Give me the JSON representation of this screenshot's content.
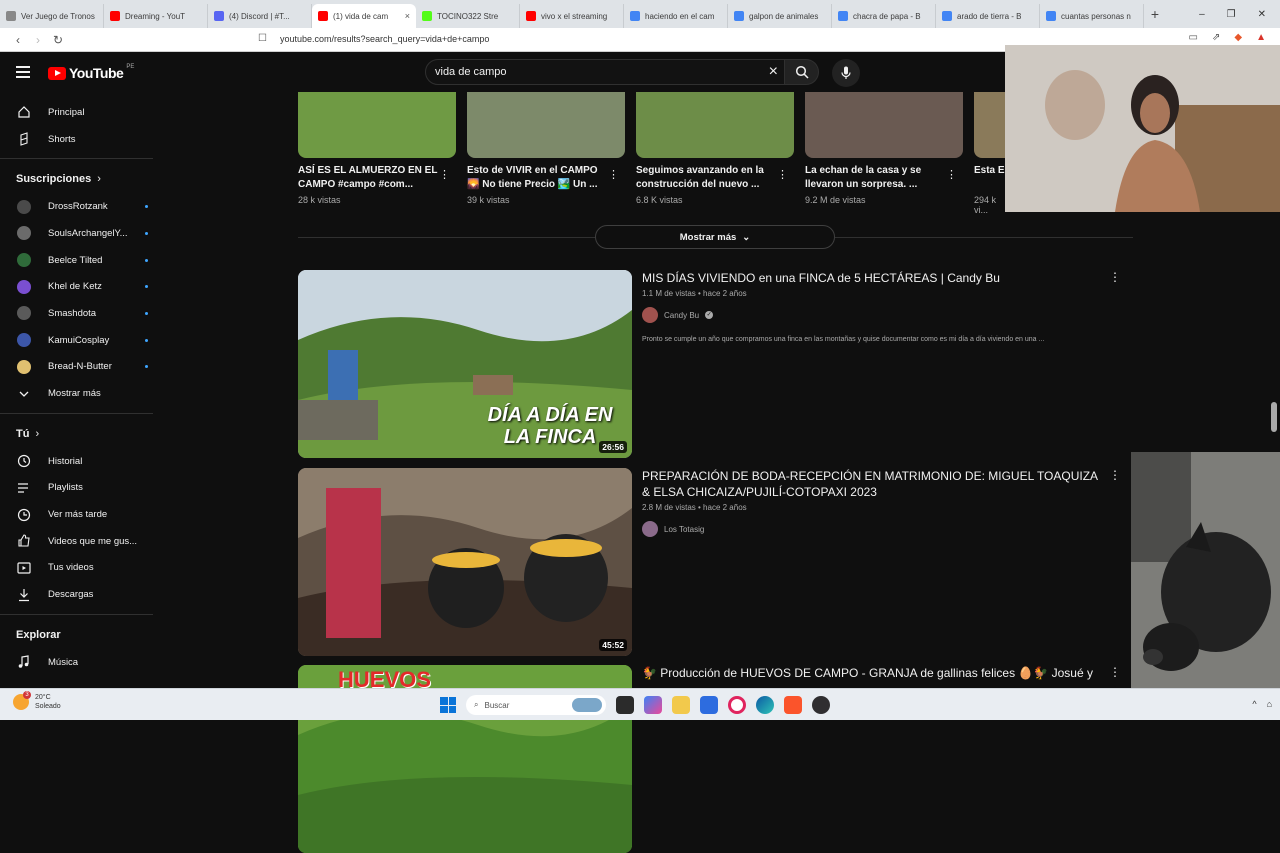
{
  "browser": {
    "tabs": [
      {
        "label": "Ver Juego de Tronos",
        "color": "#888888"
      },
      {
        "label": "Dreaming - YouT",
        "color": "#ff0000"
      },
      {
        "label": "(4) Discord | #T...",
        "color": "#5865f2"
      },
      {
        "label": "(1) vida de cam",
        "color": "#ff0000",
        "active": true
      },
      {
        "label": "TOCINO322 Stre",
        "color": "#53fc18"
      },
      {
        "label": "vivo x el streaming",
        "color": "#ff0000"
      },
      {
        "label": "haciendo en el cam",
        "color": "#4285f4"
      },
      {
        "label": "galpon de animales",
        "color": "#4285f4"
      },
      {
        "label": "chacra de papa - B",
        "color": "#4285f4"
      },
      {
        "label": "arado de tierra - B",
        "color": "#4285f4"
      },
      {
        "label": "cuantas personas n",
        "color": "#4285f4"
      }
    ],
    "url": "youtube.com/results?search_query=vida+de+campo"
  },
  "header": {
    "logo_text": "YouTube",
    "country": "PE",
    "search_value": "vida de campo"
  },
  "sidebar": {
    "main": [
      {
        "label": "Principal",
        "icon": "home-icon"
      },
      {
        "label": "Shorts",
        "icon": "shorts-icon"
      }
    ],
    "subscriptions_title": "Suscripciones",
    "subscriptions": [
      {
        "label": "DrossRotzank",
        "color": "#4a4a4a"
      },
      {
        "label": "SoulsArchangelY...",
        "color": "#6b6b6b"
      },
      {
        "label": "Beelce Tilted",
        "color": "#2f6b3a"
      },
      {
        "label": "Khel de Ketz",
        "color": "#7a4fd1"
      },
      {
        "label": "Smashdota",
        "color": "#5a5a5a"
      },
      {
        "label": "KamuiCosplay",
        "color": "#3c56a8"
      },
      {
        "label": "Bread-N-Butter",
        "color": "#e0c070"
      }
    ],
    "show_more": "Mostrar más",
    "you_title": "Tú",
    "you": [
      {
        "label": "Historial",
        "icon": "history-icon"
      },
      {
        "label": "Playlists",
        "icon": "playlists-icon"
      },
      {
        "label": "Ver más tarde",
        "icon": "watch-later-icon"
      },
      {
        "label": "Videos que me gus...",
        "icon": "like-icon"
      },
      {
        "label": "Tus videos",
        "icon": "your-videos-icon"
      },
      {
        "label": "Descargas",
        "icon": "download-icon"
      }
    ],
    "explore_title": "Explorar",
    "explore": [
      {
        "label": "Música",
        "icon": "music-icon"
      }
    ]
  },
  "shorts": [
    {
      "title": "ASÍ ES EL ALMUERZO EN EL CAMPO #campo #com...",
      "views": "28 k vistas",
      "color": "#6f9a44"
    },
    {
      "title": "Esto de VIVIR en el CAMPO 🌄 No tiene Precio 🏞️ Un ...",
      "views": "39 k vistas",
      "color": "#7d8a6a"
    },
    {
      "title": "Seguimos avanzando en la construcción del nuevo ...",
      "views": "6.8 K vistas",
      "color": "#6d8d48"
    },
    {
      "title": "La echan de la casa y se llevaron un sorpresa. ...",
      "views": "9.2 M de vistas",
      "color": "#6a5a52"
    },
    {
      "title": "Esta Es... Felicid...",
      "views": "294 k vi...",
      "color": "#8a7a5a"
    }
  ],
  "show_more_button": "Mostrar más",
  "videos": [
    {
      "title": "MIS DÍAS VIVIENDO en una FINCA de 5 HECTÁREAS | Candy Bu",
      "meta": "1.1 M de vistas • hace 2 años",
      "channel": "Candy Bu",
      "description": "Pronto se cumple un año que compramos una finca en las montañas y quise documentar como es mi día a día viviendo en una ...",
      "duration": "26:56",
      "overlay_text": "DÍA A DÍA EN LA FINCA",
      "colors": {
        "sky": "#c9d6df",
        "hill": "#4f7a32",
        "ground": "#6d9a3f"
      }
    },
    {
      "title": "PREPARACIÓN DE BODA-RECEPCIÓN EN MATRIMONIO DE: MIGUEL TOAQUIZA & ELSA CHICAIZA/PUJILÍ-COTOPAXI 2023",
      "meta": "2.8 M de vistas • hace 2 años",
      "channel": "Los Totasig",
      "description": "",
      "duration": "45:52",
      "overlay_text": "",
      "colors": {
        "sky": "#8c7d6c",
        "hill": "#5e5044",
        "ground": "#3a2c24"
      }
    },
    {
      "title": "🐓 Producción de HUEVOS DE CAMPO - GRANJA de gallinas felices 🥚🐓 Josué y",
      "meta": "",
      "channel": "",
      "description": "",
      "duration": "",
      "overlay_text": "HUEVOS",
      "colors": {
        "sky": "#6aa03c",
        "hill": "#4c8a2c",
        "ground": "#3f7526"
      }
    }
  ],
  "taskbar": {
    "temperature": "20°C",
    "condition": "Soleado",
    "badge": "3",
    "search_placeholder": "Buscar"
  }
}
